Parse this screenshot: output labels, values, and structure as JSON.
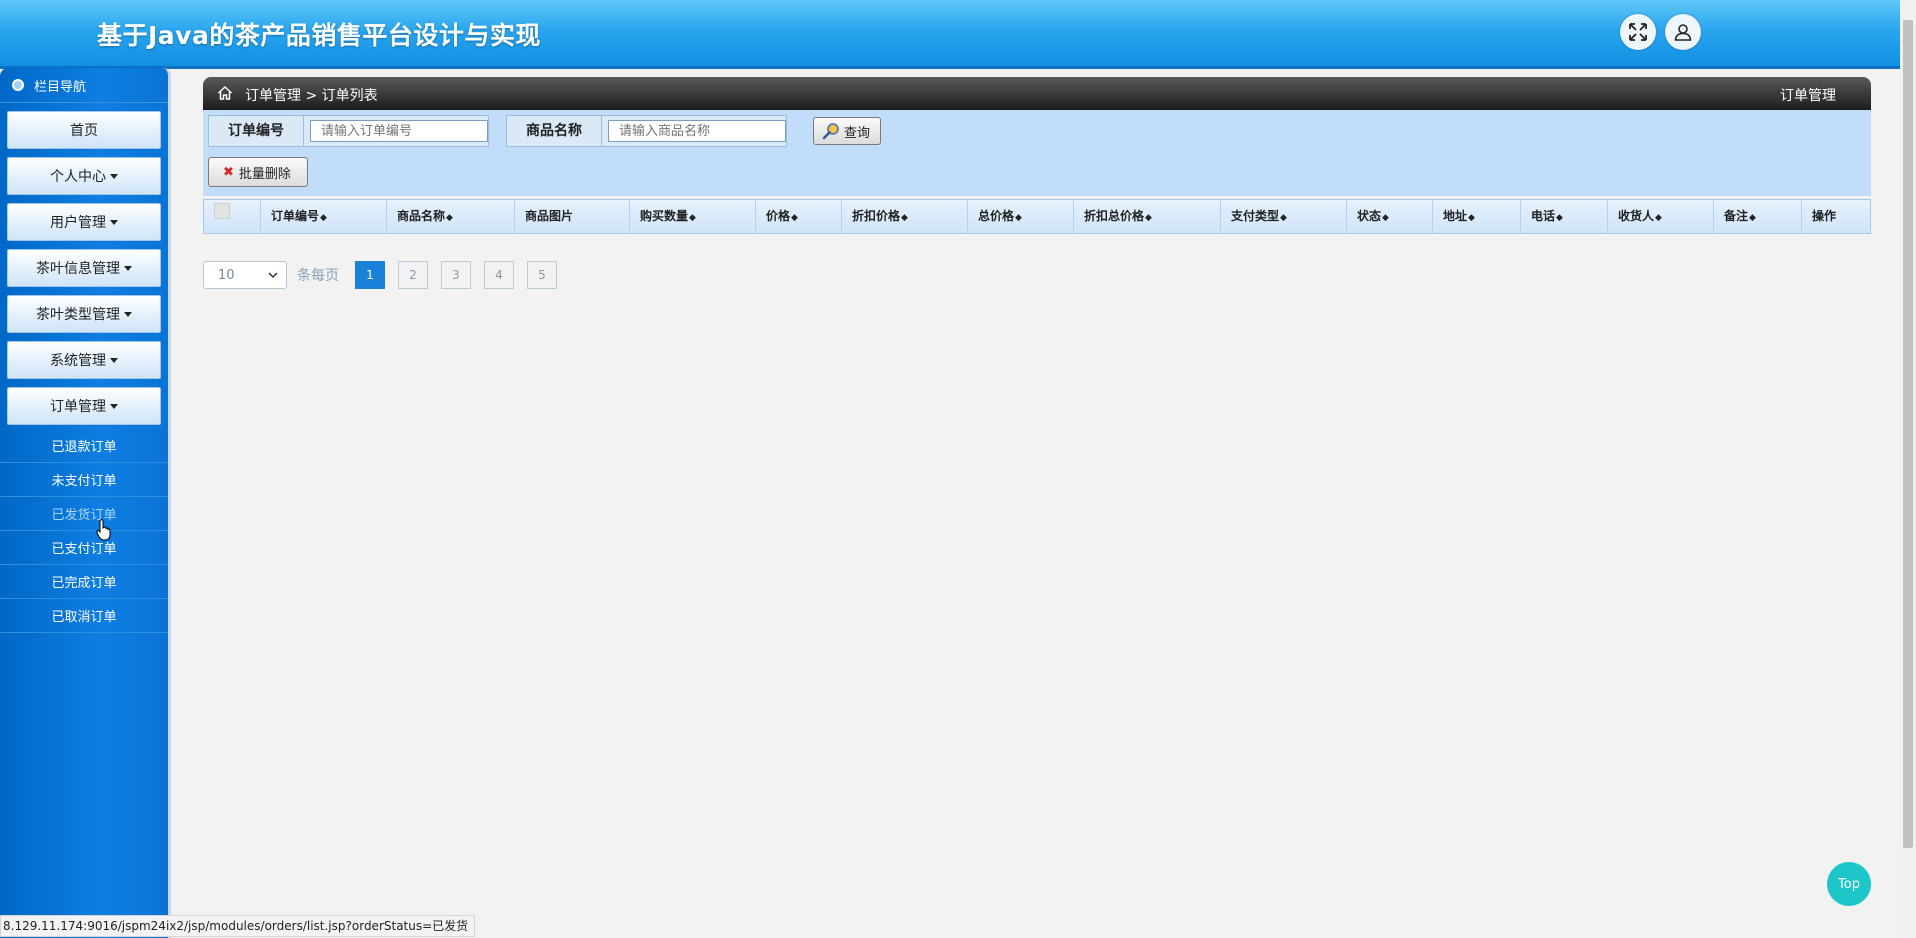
{
  "header": {
    "title": "基于Java的茶产品销售平台设计与实现",
    "fullscreen_icon": "expand-icon",
    "user_icon": "user-icon"
  },
  "sidebar": {
    "head": "栏目导航",
    "items": [
      {
        "label": "首页",
        "caret": false
      },
      {
        "label": "个人中心",
        "caret": true
      },
      {
        "label": "用户管理",
        "caret": true
      },
      {
        "label": "茶叶信息管理",
        "caret": true
      },
      {
        "label": "茶叶类型管理",
        "caret": true
      },
      {
        "label": "系统管理",
        "caret": true
      },
      {
        "label": "订单管理",
        "caret": true
      }
    ],
    "sub_items": [
      "已退款订单",
      "未支付订单",
      "已发货订单",
      "已支付订单",
      "已完成订单",
      "已取消订单"
    ]
  },
  "breadcrumb": {
    "path": "订单管理 > 订单列表",
    "right": "订单管理"
  },
  "search": {
    "order_no_label": "订单编号",
    "order_no_placeholder": "请输入订单编号",
    "goods_name_label": "商品名称",
    "goods_name_placeholder": "请输入商品名称",
    "query_label": "查询",
    "batch_delete_label": "批量删除"
  },
  "table": {
    "columns": [
      "订单编号",
      "商品名称",
      "商品图片",
      "购买数量",
      "价格",
      "折扣价格",
      "总价格",
      "折扣总价格",
      "支付类型",
      "状态",
      "地址",
      "电话",
      "收货人",
      "备注",
      "操作"
    ]
  },
  "pager": {
    "page_size": "10",
    "per_page_label": "条每页",
    "pages": [
      "1",
      "2",
      "3",
      "4",
      "5"
    ]
  },
  "status_url": "8.129.11.174:9016/jspm24ix2/jsp/modules/orders/list.jsp?orderStatus=已发货",
  "top_label": "Top",
  "colors": {
    "header": "#118ee2",
    "sidebar": "#0a74d6",
    "accent": "#1981d8",
    "top_button": "#1dc7c9"
  }
}
